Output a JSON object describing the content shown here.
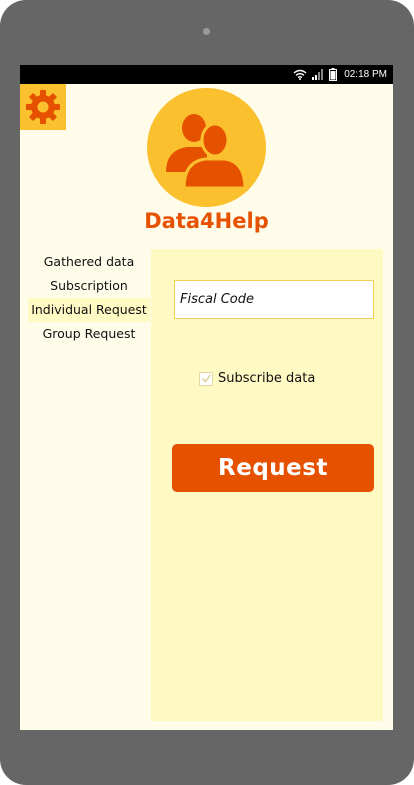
{
  "status_bar": {
    "time": "02:18 PM"
  },
  "app": {
    "title": "Data4Help"
  },
  "sidebar": {
    "items": [
      {
        "label": "Gathered data"
      },
      {
        "label": "Subscription"
      },
      {
        "label": "Individual Request"
      },
      {
        "label": "Group Request"
      }
    ]
  },
  "form": {
    "fiscal_code_placeholder": "Fiscal Code",
    "subscribe_label": "Subscribe data",
    "subscribe_checked": true,
    "request_label": "Request"
  },
  "colors": {
    "accent": "#e65100",
    "yellow": "#fbc02d",
    "panel": "#fff9c4",
    "background": "#fffcea"
  }
}
